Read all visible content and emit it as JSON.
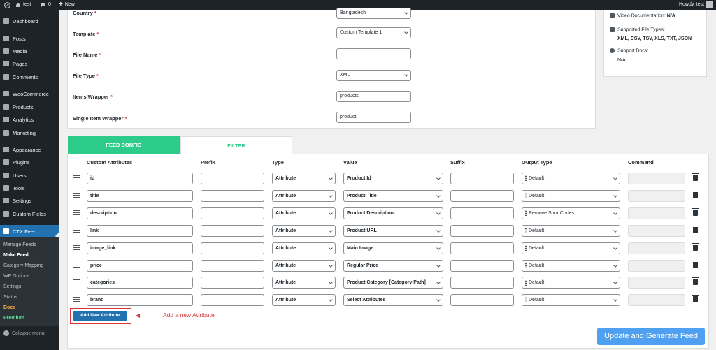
{
  "adminbar": {
    "site_name": "test",
    "comments_count": "0",
    "new_label": "New",
    "greeting": "Howdy, test"
  },
  "sidebar": {
    "items": [
      {
        "label": "Dashboard",
        "icon": "dashboard-icon"
      },
      {
        "label": "Posts",
        "icon": "pin-icon"
      },
      {
        "label": "Media",
        "icon": "media-icon"
      },
      {
        "label": "Pages",
        "icon": "pages-icon"
      },
      {
        "label": "Comments",
        "icon": "comment-icon"
      },
      {
        "label": "WooCommerce",
        "icon": "woo-icon"
      },
      {
        "label": "Products",
        "icon": "box-icon"
      },
      {
        "label": "Analytics",
        "icon": "chart-icon"
      },
      {
        "label": "Marketing",
        "icon": "megaphone-icon"
      },
      {
        "label": "Appearance",
        "icon": "brush-icon"
      },
      {
        "label": "Plugins",
        "icon": "plug-icon"
      },
      {
        "label": "Users",
        "icon": "user-icon"
      },
      {
        "label": "Tools",
        "icon": "wrench-icon"
      },
      {
        "label": "Settings",
        "icon": "settings-icon"
      },
      {
        "label": "Custom Fields",
        "icon": "fields-icon"
      },
      {
        "label": "CTX Feed",
        "icon": "feed-icon"
      }
    ],
    "submenu": [
      "Manage Feeds",
      "Make Feed",
      "Category Mapping",
      "WP Options",
      "Settings",
      "Status",
      "Docs",
      "Premium"
    ],
    "collapse_label": "Collapse menu"
  },
  "form": {
    "fields": [
      {
        "label": "Country",
        "required": "*",
        "value": "Bangladesh",
        "type": "select"
      },
      {
        "label": "Template",
        "required": "*",
        "value": "Custom Template 1",
        "type": "select"
      },
      {
        "label": "File Name",
        "required": "*",
        "value": "",
        "type": "text"
      },
      {
        "label": "File Type",
        "required": "*",
        "value": "XML",
        "type": "select"
      },
      {
        "label": "Items Wrapper",
        "required": "*",
        "value": "products",
        "type": "text"
      },
      {
        "label": "Single Item Wrapper",
        "required": "*",
        "value": "product",
        "type": "text"
      }
    ]
  },
  "info": {
    "video_label": "Video Documentation:",
    "video_value": "N/A",
    "filetypes_label": "Supported File Types:",
    "filetypes_value": "XML, CSV, TSV, XLS, TXT, JSON",
    "support_label": "Support Docs:",
    "support_value": "N/A"
  },
  "tabs": {
    "feed_config": "FEED CONFIG",
    "filter": "FILTER",
    "active_color": "#2ecc8b",
    "inactive_text_color": "#2ecc8b"
  },
  "table": {
    "headers": [
      "Custom Attributes",
      "Prefix",
      "Type",
      "Value",
      "Suffix",
      "Output Type",
      "Command"
    ],
    "rows": [
      {
        "attr": "id",
        "prefix": "",
        "type": "Attribute",
        "value": "Product Id",
        "suffix": "",
        "output": "Default",
        "command": ""
      },
      {
        "attr": "title",
        "prefix": "",
        "type": "Attribute",
        "value": "Product Title",
        "suffix": "",
        "output": "Default",
        "command": ""
      },
      {
        "attr": "description",
        "prefix": "",
        "type": "Attribute",
        "value": "Product Description",
        "suffix": "",
        "output": "Remove ShortCodes",
        "command": ""
      },
      {
        "attr": "link",
        "prefix": "",
        "type": "Attribute",
        "value": "Product URL",
        "suffix": "",
        "output": "Default",
        "command": ""
      },
      {
        "attr": "image_link",
        "prefix": "",
        "type": "Attribute",
        "value": "Main Image",
        "suffix": "",
        "output": "Default",
        "command": ""
      },
      {
        "attr": "price",
        "prefix": "",
        "type": "Attribute",
        "value": "Regular Price",
        "suffix": "",
        "output": "Default",
        "command": ""
      },
      {
        "attr": "categories",
        "prefix": "",
        "type": "Attribute",
        "value": "Product Category [Category Path]",
        "suffix": "",
        "output": "Default",
        "command": ""
      },
      {
        "attr": "brand",
        "prefix": "",
        "type": "Attribute",
        "value": "Select Attributes",
        "suffix": "",
        "output": "Default",
        "command": ""
      }
    ]
  },
  "actions": {
    "add_label": "Add New Attribute",
    "annotation": "Add a new Attribute",
    "update_label": "Update and Generate Feed"
  }
}
